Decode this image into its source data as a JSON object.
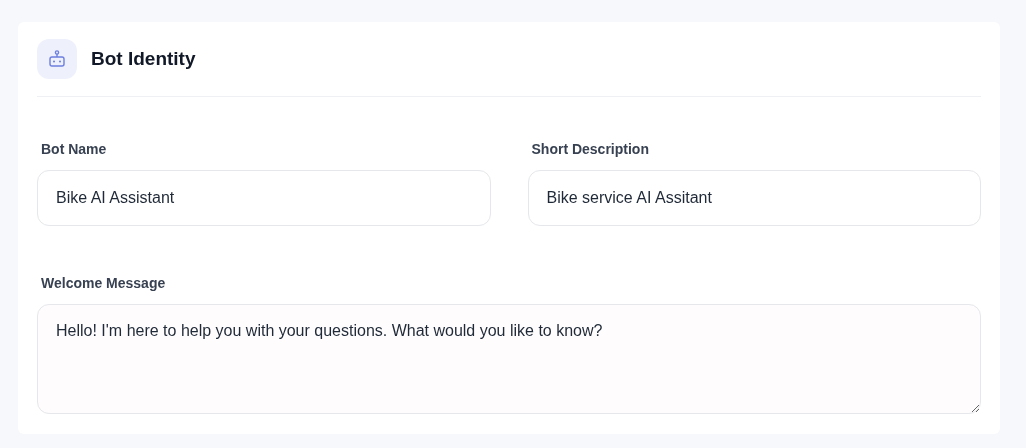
{
  "section": {
    "title": "Bot Identity"
  },
  "fields": [
    {
      "kind": "input",
      "label": "Bot Name",
      "value": "Bike AI Assistant"
    },
    {
      "kind": "input",
      "label": "Short Description",
      "value": "Bike service AI Assitant"
    },
    {
      "kind": "textarea",
      "label": "Welcome Message",
      "value": "Hello! I'm here to help you with your questions. What would you like to know?"
    }
  ]
}
